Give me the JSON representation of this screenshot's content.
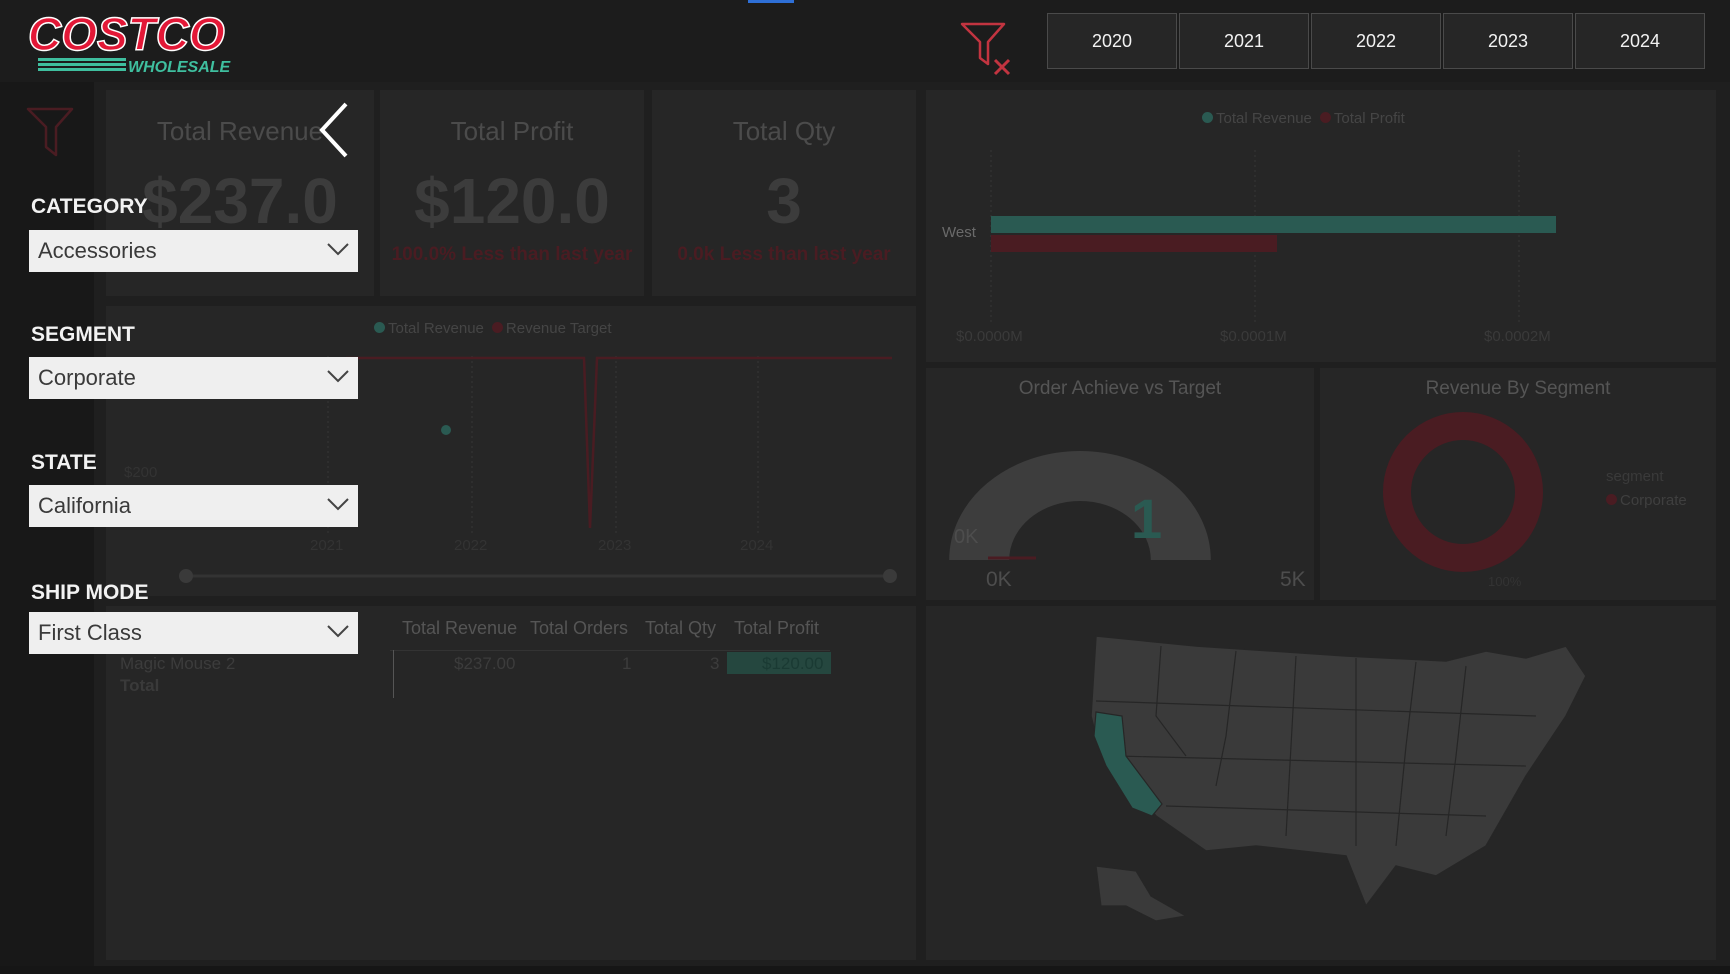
{
  "brand": {
    "name": "COSTCO",
    "tagline": "WHOLESALE"
  },
  "years": [
    "2020",
    "2021",
    "2022",
    "2023",
    "2024"
  ],
  "kpis": [
    {
      "title": "Total Revenue",
      "value": "$237.0",
      "sub": ""
    },
    {
      "title": "Total Profit",
      "value": "$120.0",
      "sub": "100.0% Less than last year"
    },
    {
      "title": "Total Qty",
      "value": "3",
      "sub": "0.0k Less than last year"
    }
  ],
  "filters": [
    {
      "label": "CATEGORY",
      "value": "Accessories"
    },
    {
      "label": "SEGMENT",
      "value": "Corporate"
    },
    {
      "label": "STATE",
      "value": "California"
    },
    {
      "label": "SHIP MODE",
      "value": "First Class"
    }
  ],
  "region_chart": {
    "legend": [
      "Total Revenue",
      "Total Profit"
    ],
    "category": "West",
    "ticks": [
      "$0.0000M",
      "$0.0001M",
      "$0.0002M"
    ]
  },
  "line_chart": {
    "legend": [
      "Total Revenue",
      "Revenue Target"
    ],
    "y_tick": "$200",
    "x_ticks": [
      "2021",
      "2022",
      "2023",
      "2024"
    ]
  },
  "gauge": {
    "title": "Order Achieve vs Target",
    "value": "1",
    "min": "0K",
    "max": "5K",
    "target": "0K"
  },
  "donut": {
    "title": "Revenue By Segment",
    "legend_title": "segment",
    "legend_item": "Corporate",
    "pct": "100%"
  },
  "table": {
    "headers": [
      "Total Revenue",
      "Total Orders",
      "Total Qty",
      "Total Profit"
    ],
    "rows": [
      {
        "name": "Magic Mouse 2",
        "revenue": "$237.00",
        "orders": "1",
        "qty": "3",
        "profit": "$120.00"
      }
    ],
    "total_label": "Total"
  },
  "colors": {
    "teal": "#2a5a52",
    "red": "#4a1c22",
    "slicer_bg": "#efefef",
    "accent_blue": "#2e6fd6"
  },
  "chart_data": [
    {
      "type": "bar",
      "categories": [
        "West"
      ],
      "series": [
        {
          "name": "Total Revenue",
          "values": [
            237
          ]
        },
        {
          "name": "Total Profit",
          "values": [
            120
          ]
        }
      ]
    }
  ]
}
